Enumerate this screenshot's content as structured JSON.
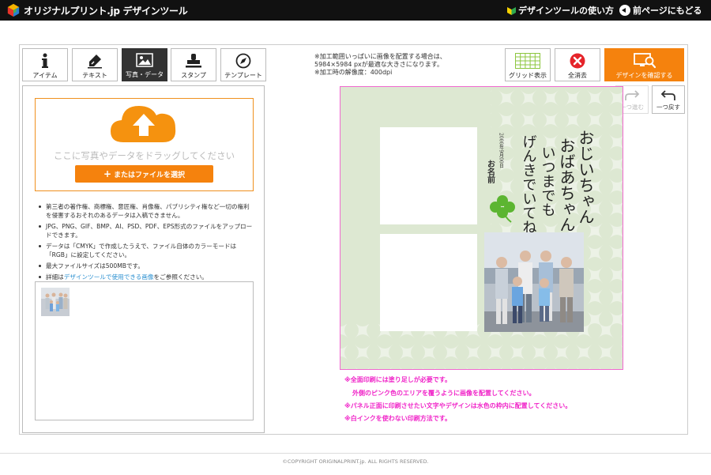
{
  "header": {
    "logo_text": "オリジナルプリント.jp デザインツール",
    "help_link": "デザインツールの使い方",
    "back_link": "前ページにもどる"
  },
  "tabs": [
    {
      "label": "アイテム",
      "icon": "info-icon"
    },
    {
      "label": "テキスト",
      "icon": "pen-icon"
    },
    {
      "label": "写真・データ",
      "icon": "image-icon",
      "active": true
    },
    {
      "label": "スタンプ",
      "icon": "stamp-icon"
    },
    {
      "label": "テンプレート",
      "icon": "compass-icon"
    }
  ],
  "upload": {
    "drop_text": "ここに写真やデータをドラッグしてください",
    "select_button": "またはファイルを選択"
  },
  "notes": {
    "n1": "第三者の著作権、商標権、意匠権、肖像権、パブリシティ権など一切の権利を侵害するおそれのあるデータは入稿できません。",
    "n2": "JPG、PNG、GIF、BMP、AI、PSD、PDF、EPS形式のファイルをアップロードできます。",
    "n3": "データは「CMYK」で作成したうえで、ファイル自体のカラーモードは「RGB」に設定してください。",
    "n4": "最大ファイルサイズは500MBです。",
    "n5_pre": "詳細は",
    "n5_link": "デザインツールで使用できる画像",
    "n5_post": "をご参照ください。"
  },
  "info": {
    "line1": "※加工範囲いっぱいに画像を配置する場合は、",
    "line2": "5984×5984 pxが最適な大きさになります。",
    "line3": "※加工時の解像度：400dpi"
  },
  "toolbar": {
    "grid_label": "グリッド表示",
    "clear_label": "全消去",
    "confirm_label": "デザインを確認する",
    "redo_label": "一つ進む",
    "undo_label": "一つ戻す"
  },
  "design": {
    "calligraphy_col1": "おじいちゃん",
    "calligraphy_col2": "おばあちゃん",
    "calligraphy_col3": "いつまでも",
    "calligraphy_col4": "げんきでいてね",
    "date_text": "2000年9月00日",
    "name_text": "お名前"
  },
  "warnings": {
    "w1": "※全面印刷には塗り足しが必要です。",
    "w2": "外側のピンク色のエリアを覆うように画像を配置してください。",
    "w3": "※パネル正面に印刷させたい文字やデザインは水色の枠内に配置してください。",
    "w4": "※白インクを使わない印刷方法です。"
  },
  "footer": {
    "copyright": "©COPYRIGHT ORIGINALPRINT.jp. ALL RIGHTS RESERVED."
  },
  "colors": {
    "accent_orange": "#f5820d",
    "warning_pink": "#f024c8",
    "canvas_green": "#dde8d2"
  }
}
